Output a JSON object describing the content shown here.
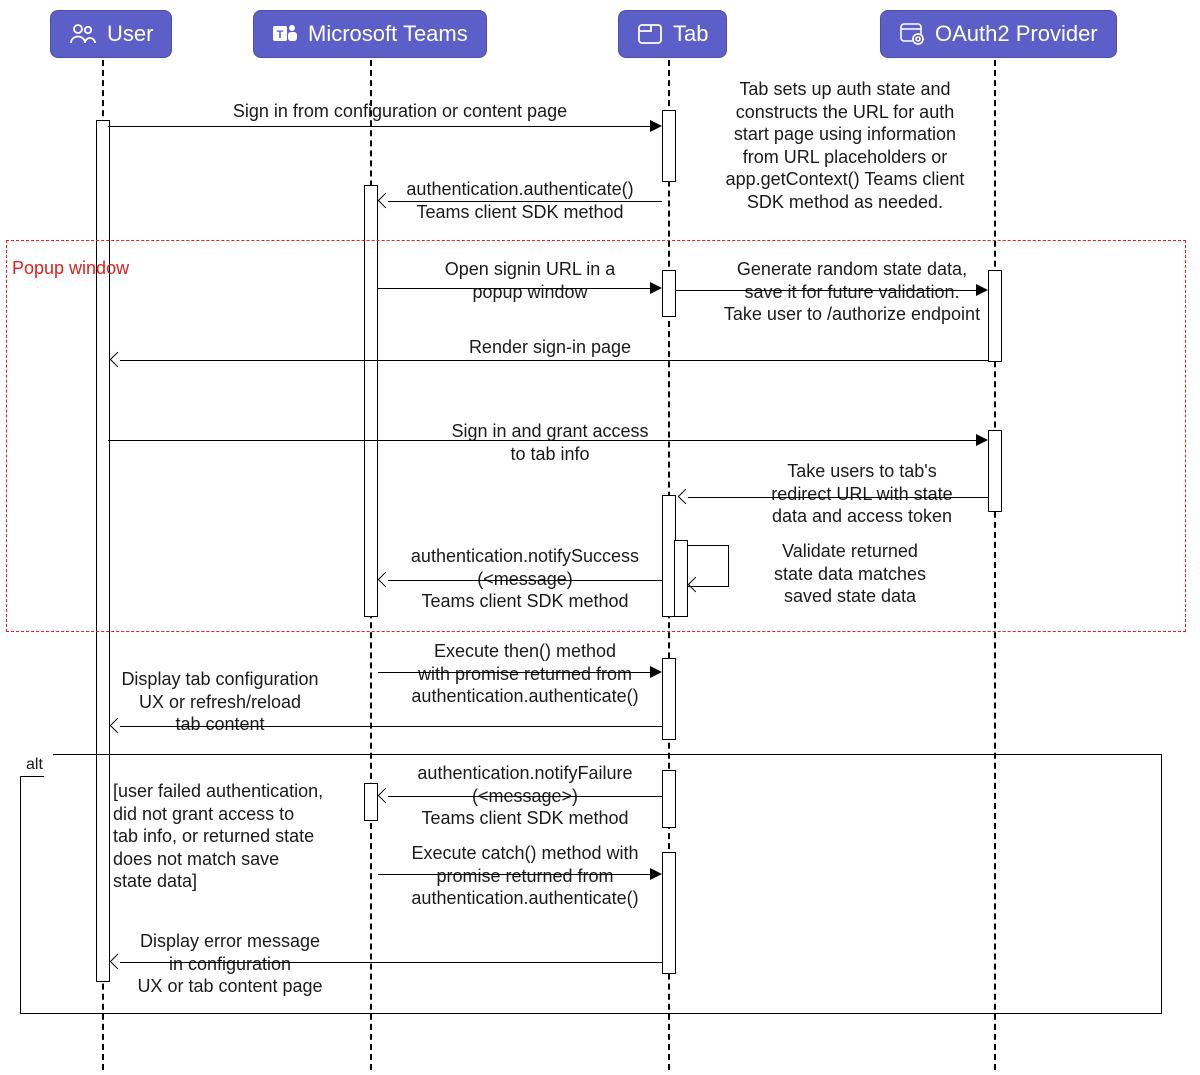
{
  "participants": {
    "user": "User",
    "teams": "Microsoft Teams",
    "tab": "Tab",
    "oauth": "OAuth2 Provider"
  },
  "labels": {
    "popup": "Popup\nwindow",
    "alt": "alt"
  },
  "notes": {
    "tab_setup": "Tab sets up auth state and\nconstructs the URL for auth\nstart page using information\nfrom URL placeholders or\napp.getContext() Teams client\nSDK method as needed.",
    "generate_state": "Generate random state data,\nsave it for future validation.\nTake user to /authorize endpoint",
    "redirect": "Take users to tab's\nredirect URL with state\ndata and access token",
    "validate": "Validate returned\nstate data matches\nsaved state data",
    "alt_cond": "[user failed authentication,\ndid not grant access to\ntab info, or returned state\ndoes not match save\nstate data]"
  },
  "messages": {
    "signin_start": "Sign in from configuration or content page",
    "auth_authenticate": "authentication.authenticate()\nTeams client SDK method",
    "open_popup": "Open signin URL in a\npopup window",
    "render_signin": "Render sign-in page",
    "signin_grant": "Sign in and grant access\nto tab info",
    "notify_success": "authentication.notifySuccess\n(<message)\nTeams client SDK method",
    "exec_then": "Execute then() method\nwith promise returned from\nauthentication.authenticate()",
    "display_config": "Display tab configuration\nUX or refresh/reload\ntab content",
    "notify_failure": "authentication.notifyFailure\n(<message>)\nTeams client SDK method",
    "exec_catch": "Execute catch() method with\npromise returned from\nauthentication.authenticate()",
    "display_error": "Display error message\nin configuration\nUX or tab content page"
  }
}
